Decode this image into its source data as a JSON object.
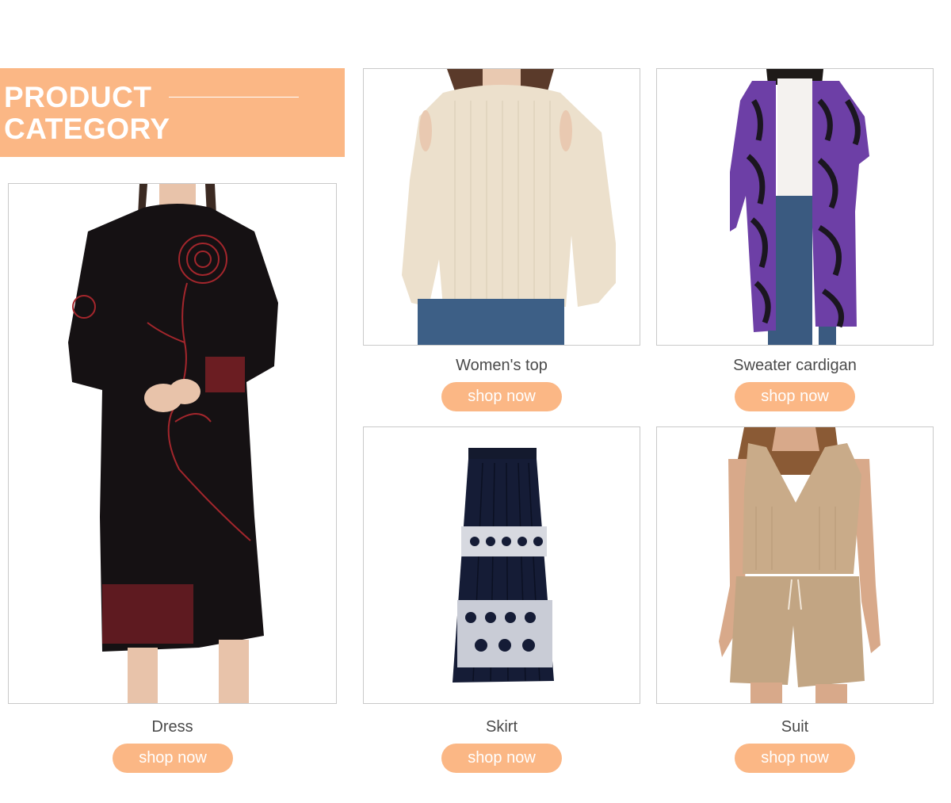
{
  "banner": {
    "title_line1": "PRODUCT",
    "title_line2": "CATEGORY",
    "background": "#fbb785"
  },
  "products": [
    {
      "name": "Dress",
      "button_label": "shop now"
    },
    {
      "name": "Women's top",
      "button_label": "shop now"
    },
    {
      "name": "Sweater cardigan",
      "button_label": "shop now"
    },
    {
      "name": "Skirt",
      "button_label": "shop now"
    },
    {
      "name": "Suit",
      "button_label": "shop now"
    }
  ],
  "colors": {
    "accent": "#fbb785",
    "caption_text": "#4a4a4a",
    "frame_border": "#c9c9c9"
  }
}
